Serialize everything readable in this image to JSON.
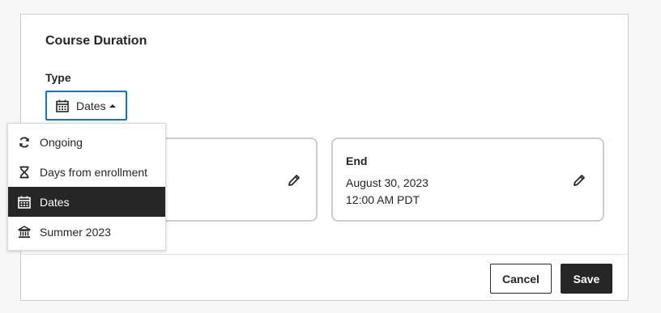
{
  "section": {
    "title": "Course Duration"
  },
  "type_field": {
    "label": "Type",
    "selected_label": "Dates"
  },
  "cards": {
    "end": {
      "title": "End",
      "date": "August 30, 2023",
      "time": "12:00 AM PDT"
    }
  },
  "footer": {
    "cancel_label": "Cancel",
    "save_label": "Save"
  },
  "dropdown": {
    "items": [
      {
        "label": "Ongoing",
        "icon": "refresh-icon"
      },
      {
        "label": "Days from enrollment",
        "icon": "hourglass-icon"
      },
      {
        "label": "Dates",
        "icon": "calendar-icon",
        "selected": true
      },
      {
        "label": "Summer 2023",
        "icon": "institution-icon"
      }
    ]
  },
  "colors": {
    "accent_border": "#1874c1",
    "selected_bg": "#262626",
    "text": "#262626"
  }
}
